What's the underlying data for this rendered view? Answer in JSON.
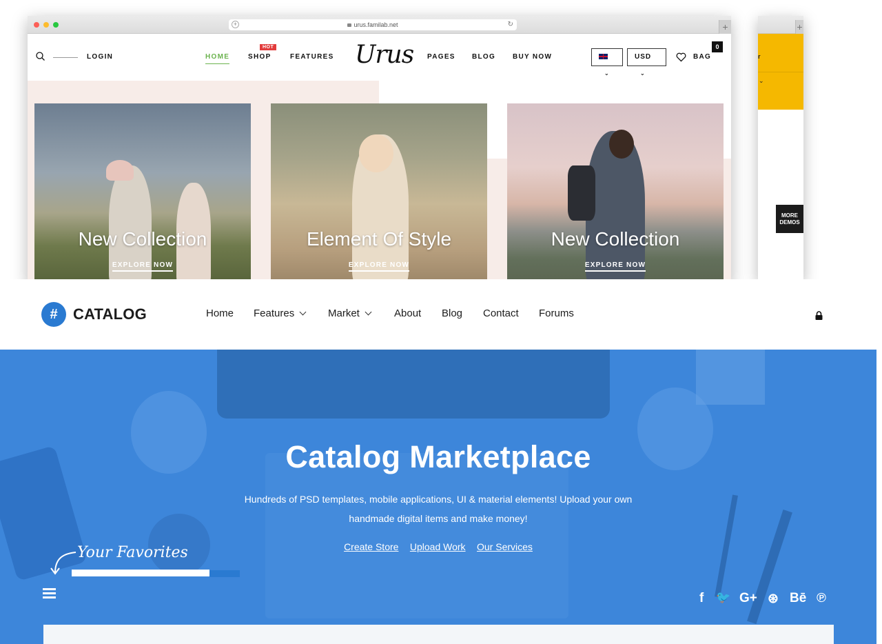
{
  "urus": {
    "url": "urus.familab.net",
    "login": "LOGIN",
    "nav_left": [
      "HOME",
      "SHOP",
      "FEATURES"
    ],
    "hot_badge": "HOT",
    "logo": "Urus",
    "nav_right": [
      "PAGES",
      "BLOG",
      "BUY NOW"
    ],
    "currency": "USD",
    "bag_label": "BAG",
    "bag_count": "0",
    "cards": [
      {
        "title": "New Collection",
        "cta": "EXPLORE NOW"
      },
      {
        "title": "Element Of Style",
        "cta": "EXPLORE NOW"
      },
      {
        "title": "New Collection",
        "cta": "EXPLORE NOW"
      }
    ],
    "more_demos": "MORE DEMOS",
    "side_partial_text": "r"
  },
  "catalog": {
    "logo_icon": "#",
    "logo_text": "CATALOG",
    "menu": [
      "Home",
      "Features",
      "Market",
      "About",
      "Blog",
      "Contact",
      "Forums"
    ],
    "hero_title": "Catalog Marketplace",
    "hero_subtitle": "Hundreds of PSD templates, mobile applications, UI & material elements! Upload your own handmade digital items and make money!",
    "hero_links": [
      "Create Store",
      "Upload Work",
      "Our Services"
    ],
    "favorites": "Your Favorites",
    "social_icons": [
      "facebook-icon",
      "twitter-icon",
      "google-plus-icon",
      "dribbble-icon",
      "behance-icon",
      "pinterest-icon"
    ],
    "social_glyphs": [
      "f",
      "🐦",
      "G+",
      "⊛",
      "Bē",
      "℗"
    ],
    "colors": {
      "accent": "#2a7ad1",
      "hero_bg": "#3d86da",
      "urus_active": "#6bb34e",
      "hot": "#e23c3c",
      "side_yellow": "#f5b800"
    }
  }
}
